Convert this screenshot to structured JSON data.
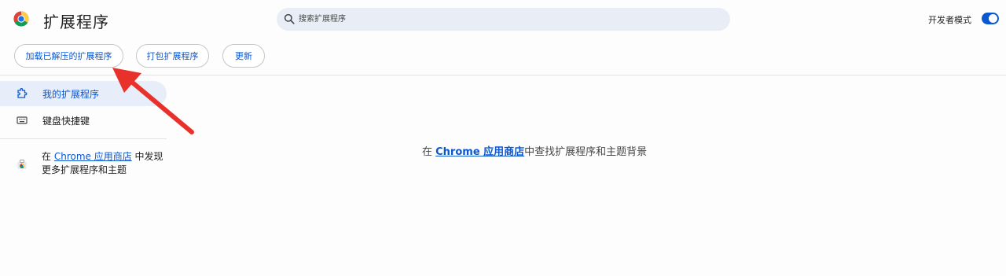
{
  "header": {
    "title": "扩展程序",
    "search": {
      "placeholder": "搜索扩展程序"
    },
    "dev_mode": {
      "label": "开发者模式",
      "enabled": true
    }
  },
  "toolbar": {
    "load_unpacked": "加载已解压的扩展程序",
    "pack": "打包扩展程序",
    "update": "更新"
  },
  "sidebar": {
    "items": [
      {
        "label": "我的扩展程序",
        "icon": "puzzle-icon",
        "active": true
      },
      {
        "label": "键盘快捷键",
        "icon": "keyboard-icon",
        "active": false
      }
    ],
    "store": {
      "prefix": "在 ",
      "link": "Chrome 应用商店",
      "suffix": " 中发现",
      "line2": "更多扩展程序和主题"
    }
  },
  "main": {
    "prefix": "在 ",
    "link": "Chrome 应用商店",
    "suffix": "中查找扩展程序和主题背景"
  },
  "colors": {
    "accent": "#0b57d0",
    "annotation": "#e8312a"
  }
}
